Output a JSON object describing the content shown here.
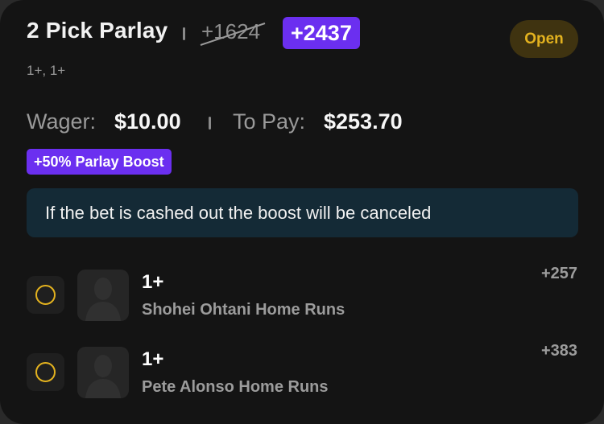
{
  "bet": {
    "title": "2 Pick Parlay",
    "original_odds": "+1624",
    "boosted_odds": "+2437",
    "status": "Open",
    "subtitle": "1+, 1+",
    "wager_label": "Wager:",
    "wager_value": "$10.00",
    "to_pay_label": "To Pay:",
    "to_pay_value": "$253.70",
    "boost_label": "+50% Parlay Boost",
    "notice": "If the bet is cashed out the boost will be canceled"
  },
  "picks": [
    {
      "line": "1+",
      "market": "Shohei Ohtani Home Runs",
      "odds": "+257",
      "icon": "player-silhouette-icon"
    },
    {
      "line": "1+",
      "market": "Pete Alonso Home Runs",
      "odds": "+383",
      "icon": "player-silhouette-icon"
    }
  ],
  "colors": {
    "card_bg": "#141414",
    "accent_purple": "#6b2ff0",
    "status_yellow": "#e3b21f",
    "notice_bg": "#142a36"
  }
}
